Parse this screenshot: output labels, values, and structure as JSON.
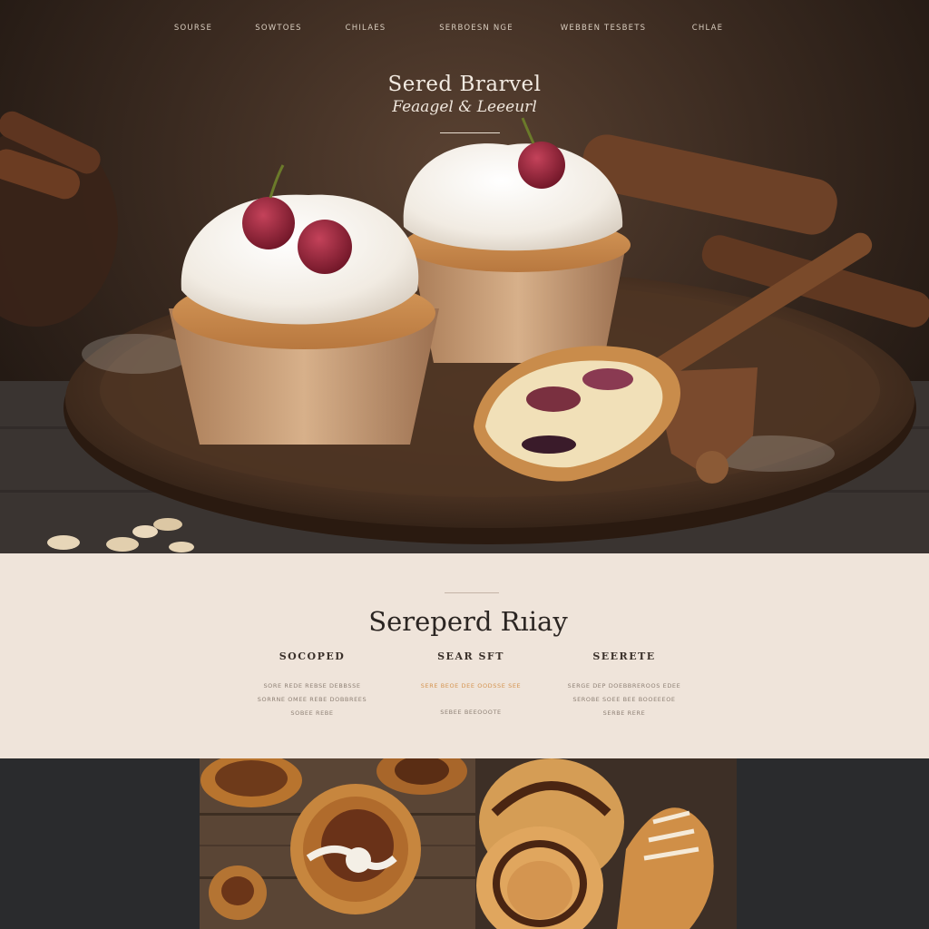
{
  "nav": {
    "items": [
      {
        "label": "SOURSE"
      },
      {
        "label": "SOWTOES"
      },
      {
        "label": "CHILAES"
      },
      {
        "label": "SERBOESN NGE"
      },
      {
        "label": "WEBBEN TESBETS"
      },
      {
        "label": "CHLAE"
      }
    ]
  },
  "hero": {
    "title": "Sered Brarvel",
    "subtitle": "Feaagel & Leeeurl"
  },
  "section": {
    "title": "Sereperd Rıiay",
    "columns": [
      {
        "heading": "SOCOPED",
        "lines": [
          "SORE REDE REBSE DEBBSSE",
          "SORRNE OMEE REBE DOBBREES",
          "SOBEE REBE"
        ],
        "accent": false
      },
      {
        "heading": "SEAR SFT",
        "lines": [
          "SERE BEOE DEE OODSSE SEE",
          "SEBEE BEEOOOTE",
          ""
        ],
        "accent": true
      },
      {
        "heading": "SEERETE",
        "lines": [
          "SERGE DEP DOEBBREROOS EDEE",
          "SEROBE SOEE BEE BOOEEEOE",
          "SERBE RERE"
        ],
        "accent": false
      }
    ]
  },
  "colors": {
    "band_background": "#efe4da",
    "accent": "#d4934f",
    "page_dark": "#2a2b2d"
  }
}
